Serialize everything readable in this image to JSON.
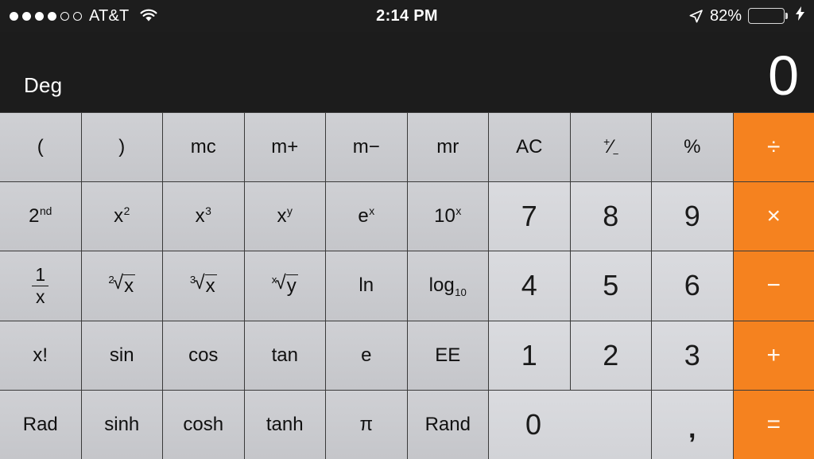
{
  "statusbar": {
    "signal_dots_filled": 4,
    "signal_dots_empty": 2,
    "carrier": "AT&T",
    "wifi_icon": "wifi-icon",
    "time": "2:14 PM",
    "location_icon": "location-arrow-icon",
    "battery_percent": "82%",
    "battery_level": 82,
    "battery_color": "#4cd964",
    "charging_icon": "lightning-bolt-icon"
  },
  "display": {
    "mode_label": "Deg",
    "value": "0"
  },
  "colors": {
    "operator": "#f5821f",
    "function_key": "#c8c9cd",
    "number_key": "#d5d6da",
    "background": "#1c1c1c"
  },
  "keypad": {
    "rows": [
      [
        {
          "label": "(",
          "name": "open-paren-key",
          "type": "func"
        },
        {
          "label": ")",
          "name": "close-paren-key",
          "type": "func"
        },
        {
          "label": "mc",
          "name": "memory-clear-key",
          "type": "func"
        },
        {
          "label": "m+",
          "name": "memory-add-key",
          "type": "func"
        },
        {
          "label": "m−",
          "name": "memory-subtract-key",
          "type": "func"
        },
        {
          "label": "mr",
          "name": "memory-recall-key",
          "type": "func"
        },
        {
          "label": "AC",
          "name": "all-clear-key",
          "type": "func"
        },
        {
          "label": "+/−",
          "name": "sign-toggle-key",
          "type": "func"
        },
        {
          "label": "%",
          "name": "percent-key",
          "type": "func"
        },
        {
          "label": "÷",
          "name": "divide-key",
          "type": "op"
        }
      ],
      [
        {
          "label": "2nd",
          "name": "second-function-key",
          "type": "func",
          "sup": "nd",
          "base": "2"
        },
        {
          "label": "x²",
          "name": "x-squared-key",
          "type": "func",
          "sup": "2",
          "base": "x"
        },
        {
          "label": "x³",
          "name": "x-cubed-key",
          "type": "func",
          "sup": "3",
          "base": "x"
        },
        {
          "label": "xʸ",
          "name": "x-to-the-y-key",
          "type": "func",
          "sup": "y",
          "base": "x"
        },
        {
          "label": "eˣ",
          "name": "e-to-the-x-key",
          "type": "func",
          "sup": "x",
          "base": "e"
        },
        {
          "label": "10ˣ",
          "name": "ten-to-the-x-key",
          "type": "func",
          "sup": "x",
          "base": "10"
        },
        {
          "label": "7",
          "name": "digit-7-key",
          "type": "num"
        },
        {
          "label": "8",
          "name": "digit-8-key",
          "type": "num"
        },
        {
          "label": "9",
          "name": "digit-9-key",
          "type": "num"
        },
        {
          "label": "×",
          "name": "multiply-key",
          "type": "op"
        }
      ],
      [
        {
          "label": "1/x",
          "name": "reciprocal-key",
          "type": "func",
          "frac": [
            "1",
            "x"
          ]
        },
        {
          "label": "²√x",
          "name": "square-root-key",
          "type": "func",
          "radical": [
            "2",
            "x"
          ]
        },
        {
          "label": "³√x",
          "name": "cube-root-key",
          "type": "func",
          "radical": [
            "3",
            "x"
          ]
        },
        {
          "label": "ˣ√y",
          "name": "nth-root-key",
          "type": "func",
          "radical": [
            "x",
            "y"
          ]
        },
        {
          "label": "ln",
          "name": "natural-log-key",
          "type": "func"
        },
        {
          "label": "log10",
          "name": "log-base-10-key",
          "type": "func",
          "base": "log",
          "sub": "10"
        },
        {
          "label": "4",
          "name": "digit-4-key",
          "type": "num"
        },
        {
          "label": "5",
          "name": "digit-5-key",
          "type": "num"
        },
        {
          "label": "6",
          "name": "digit-6-key",
          "type": "num"
        },
        {
          "label": "−",
          "name": "subtract-key",
          "type": "op"
        }
      ],
      [
        {
          "label": "x!",
          "name": "factorial-key",
          "type": "func"
        },
        {
          "label": "sin",
          "name": "sine-key",
          "type": "func"
        },
        {
          "label": "cos",
          "name": "cosine-key",
          "type": "func"
        },
        {
          "label": "tan",
          "name": "tangent-key",
          "type": "func"
        },
        {
          "label": "e",
          "name": "euler-constant-key",
          "type": "func"
        },
        {
          "label": "EE",
          "name": "exponent-entry-key",
          "type": "func"
        },
        {
          "label": "1",
          "name": "digit-1-key",
          "type": "num"
        },
        {
          "label": "2",
          "name": "digit-2-key",
          "type": "num"
        },
        {
          "label": "3",
          "name": "digit-3-key",
          "type": "num"
        },
        {
          "label": "+",
          "name": "add-key",
          "type": "op"
        }
      ],
      [
        {
          "label": "Rad",
          "name": "radians-mode-key",
          "type": "func"
        },
        {
          "label": "sinh",
          "name": "hyperbolic-sine-key",
          "type": "func"
        },
        {
          "label": "cosh",
          "name": "hyperbolic-cosine-key",
          "type": "func"
        },
        {
          "label": "tanh",
          "name": "hyperbolic-tangent-key",
          "type": "func"
        },
        {
          "label": "π",
          "name": "pi-key",
          "type": "func"
        },
        {
          "label": "Rand",
          "name": "random-key",
          "type": "func"
        },
        {
          "label": "0",
          "name": "digit-0-key",
          "type": "num",
          "span": 2
        },
        {
          "label": ",",
          "name": "decimal-separator-key",
          "type": "num comma"
        },
        {
          "label": "=",
          "name": "equals-key",
          "type": "op"
        }
      ]
    ]
  }
}
